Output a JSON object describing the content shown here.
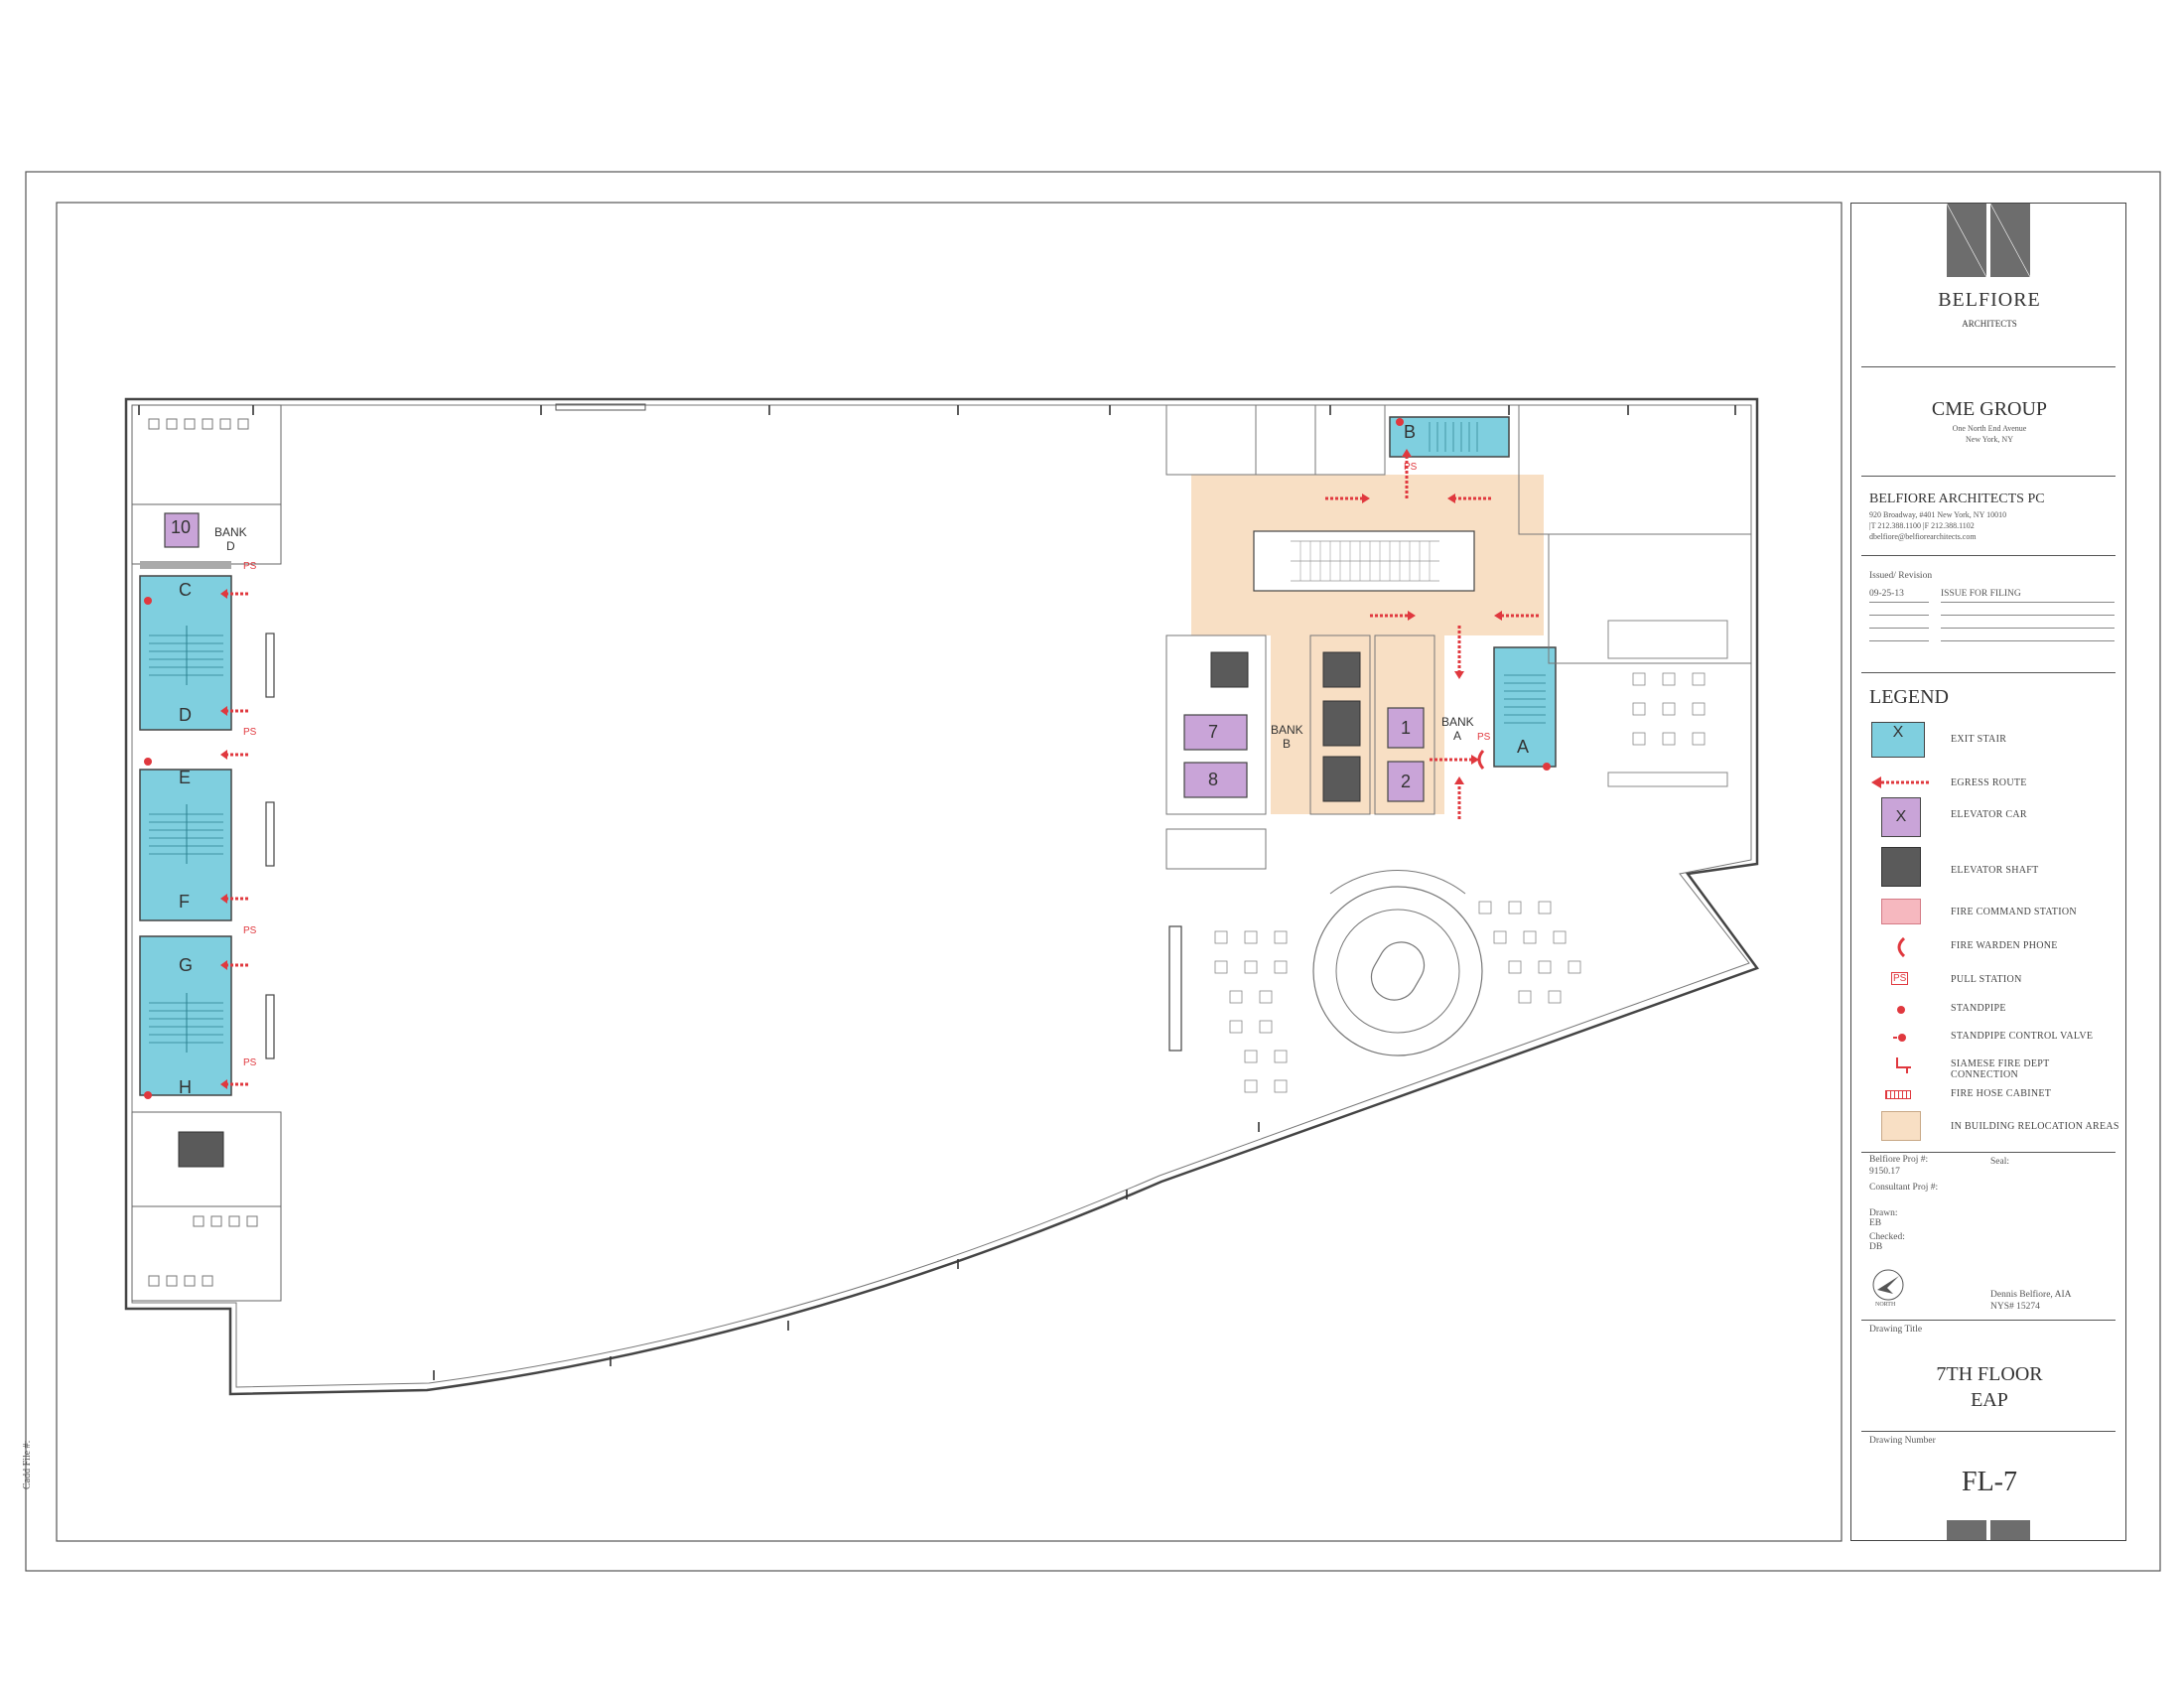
{
  "firm": {
    "name": "BELFIORE",
    "subtitle": "ARCHITECTS",
    "pc_name": "BELFIORE ARCHITECTS PC",
    "address": "920 Broadway, #401   New York, NY 10010",
    "phones": "|T  212.388.1100   |F  212.388.1102",
    "email": "dbelfiore@belfiorearchitects.com"
  },
  "client": {
    "name": "CME GROUP",
    "address1": "One North End Avenue",
    "address2": "New York, NY"
  },
  "revision": {
    "header": "Issued/ Revision",
    "date": "09-25-13",
    "description": "ISSUE FOR FILING"
  },
  "legend": {
    "title": "LEGEND",
    "items": [
      {
        "label": "EXIT STAIR",
        "mark": "X",
        "color": "#7fcfdf"
      },
      {
        "label": "EGRESS ROUTE",
        "mark": "",
        "color": "#e0383e"
      },
      {
        "label": "ELEVATOR CAR",
        "mark": "X",
        "color": "#c9a4d8"
      },
      {
        "label": "ELEVATOR SHAFT",
        "mark": "",
        "color": "#5a5a5a"
      },
      {
        "label": "FIRE COMMAND STATION",
        "mark": "",
        "color": "#f6b8bf"
      },
      {
        "label": "FIRE WARDEN PHONE",
        "mark": "",
        "color": "#e0383e"
      },
      {
        "label": "PULL STATION",
        "mark": "PS",
        "color": "#e0383e"
      },
      {
        "label": "STANDPIPE",
        "mark": "",
        "color": "#e0383e"
      },
      {
        "label": "STANDPIPE CONTROL VALVE",
        "mark": "",
        "color": "#e0383e"
      },
      {
        "label": "SIAMESE FIRE DEPT CONNECTION",
        "mark": "",
        "color": "#e0383e"
      },
      {
        "label": "FIRE HOSE CABINET",
        "mark": "",
        "color": "#e0383e"
      },
      {
        "label": "IN BUILDING RELOCATION AREAS",
        "mark": "",
        "color": "#f8dfc4"
      }
    ]
  },
  "project": {
    "proj_label": "Belfiore Proj #:",
    "proj_number": "9150.17",
    "seal_label": "Seal:",
    "consultant_label": "Consultant Proj #:",
    "drawn_label": "Drawn:",
    "drawn_by": "EB",
    "checked_label": "Checked:",
    "checked_by": "DB",
    "north_label": "NORTH",
    "signer": "Dennis Belfiore, AIA",
    "license": "NYS# 15274"
  },
  "drawing": {
    "title_label": "Drawing Title",
    "title_line1": "7TH FLOOR",
    "title_line2": "EAP",
    "number_label": "Drawing Number",
    "number": "FL-7"
  },
  "cadd_label": "Cadd File #:",
  "plan": {
    "stairs": [
      "A",
      "B",
      "C",
      "D",
      "E",
      "F",
      "G",
      "H"
    ],
    "elevator_cars": [
      "1",
      "2",
      "7",
      "8",
      "10"
    ],
    "banks": [
      {
        "line1": "BANK",
        "line2": "A"
      },
      {
        "line1": "BANK",
        "line2": "B"
      },
      {
        "line1": "BANK",
        "line2": "D"
      }
    ],
    "pull_station": "PS",
    "hose_symbol": "H",
    "column_symbol": "I"
  },
  "colors": {
    "stair": "#7fcfdf",
    "car": "#c9a4d8",
    "shaft": "#5a5a5a",
    "relocation": "#f8dfc4",
    "egress": "#e0383e",
    "logo_grey": "#6d6d6d"
  }
}
